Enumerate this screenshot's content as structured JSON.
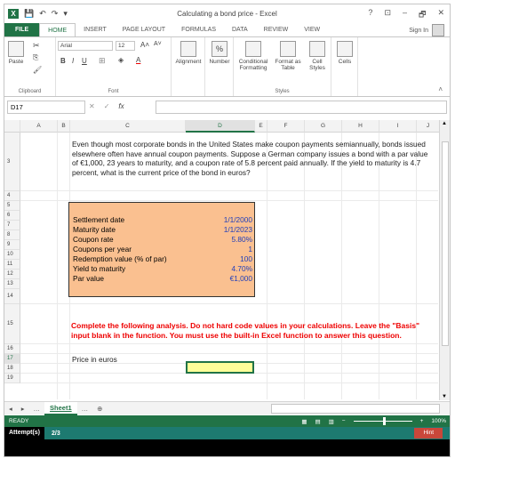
{
  "window": {
    "title": "Calculating a bond price - Excel",
    "buttons": [
      "?",
      "⊡",
      "–",
      "🗗",
      "✕"
    ],
    "sign_in": "Sign In"
  },
  "tabs": [
    "FILE",
    "HOME",
    "INSERT",
    "PAGE LAYOUT",
    "FORMULAS",
    "DATA",
    "REVIEW",
    "VIEW"
  ],
  "ribbon": {
    "clipboard": {
      "paste": "Paste",
      "label": "Clipboard"
    },
    "font": {
      "name": "Arial",
      "size": "12",
      "label": "Font"
    },
    "alignment": "Alignment",
    "number": "Number",
    "conditional": "Conditional Formatting",
    "format_table": "Format as Table",
    "cell_styles": "Cell Styles",
    "cells": "Cells",
    "styles_label": "Styles"
  },
  "formula_bar": {
    "name_box": "D17",
    "formula": ""
  },
  "columns": [
    "A",
    "B",
    "C",
    "D",
    "E",
    "F",
    "G",
    "H",
    "I",
    "J"
  ],
  "rows": [
    "3",
    "4",
    "5",
    "6",
    "7",
    "8",
    "9",
    "10",
    "11",
    "12",
    "13",
    "14",
    "15",
    "16",
    "17",
    "18",
    "19"
  ],
  "problem_text": "Even though most corporate bonds in the United States make coupon payments semiannually, bonds issued elsewhere often have annual coupon payments. Suppose a German company issues a bond with a par value of €1,000, 23 years to maturity, and a coupon rate of 5.8 percent paid annually. If the yield to maturity is 4.7 percent, what is the current price of the bond in euros?",
  "inputs": [
    {
      "label": "Settlement date",
      "value": "1/1/2000"
    },
    {
      "label": "Maturity date",
      "value": "1/1/2023"
    },
    {
      "label": "Coupon rate",
      "value": "5.80%"
    },
    {
      "label": "Coupons per year",
      "value": "1"
    },
    {
      "label": "Redemption value (% of par)",
      "value": "100"
    },
    {
      "label": "Yield to maturity",
      "value": "4.70%"
    },
    {
      "label": "Par value",
      "value": "€1,000"
    }
  ],
  "instructions": "Complete the following analysis. Do not hard code values in your calculations. Leave the \"Basis\" input blank in the function. You must use the built-in Excel function to answer this question.",
  "answer_label": "Price in euros",
  "sheet": {
    "name": "Sheet1"
  },
  "status": {
    "mode": "READY",
    "zoom": "100%"
  },
  "footer": {
    "attempt_label": "Attempt(s)",
    "attempt_value": "2/3",
    "hint": "Hint"
  },
  "colors": {
    "excel_green": "#217346",
    "input_fill": "#fac090",
    "answer_fill": "#ffff99",
    "warn": "#e00000"
  }
}
